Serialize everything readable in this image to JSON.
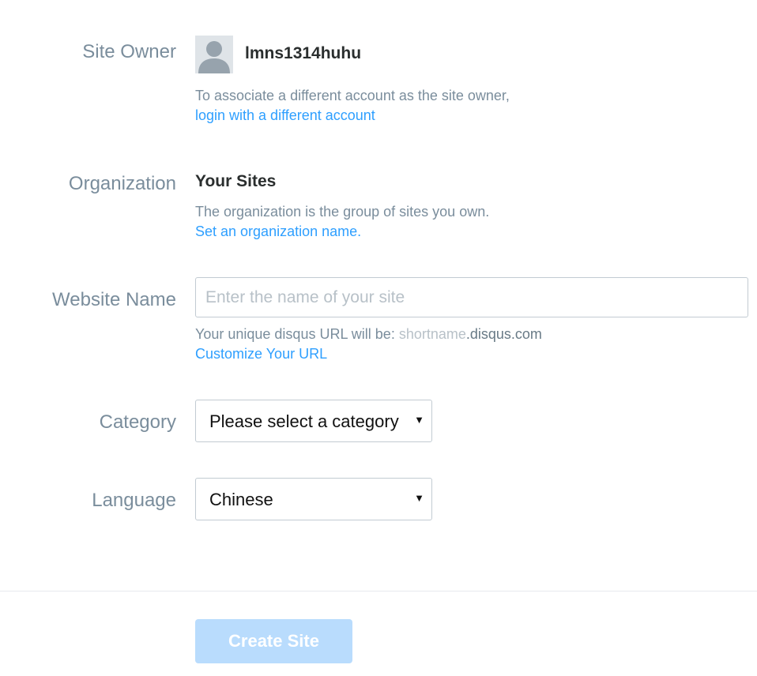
{
  "site_owner": {
    "label": "Site Owner",
    "avatar_icon": "user-avatar-icon",
    "username": "lmns1314huhu",
    "help_text": "To associate a different account as the site owner,",
    "link_text": "login with a different account"
  },
  "organization": {
    "label": "Organization",
    "name": "Your Sites",
    "help_text": "The organization is the group of sites you own.",
    "link_text": "Set an organization name."
  },
  "website_name": {
    "label": "Website Name",
    "placeholder": "Enter the name of your site",
    "value": "",
    "url_prefix": "Your unique disqus URL will be: ",
    "url_shortname": "shortname",
    "url_suffix": ".disqus.com",
    "link_text": "Customize Your URL"
  },
  "category": {
    "label": "Category",
    "selected": "Please select a category",
    "caret_icon": "caret-down-icon"
  },
  "language": {
    "label": "Language",
    "selected": "Chinese",
    "caret_icon": "caret-down-icon"
  },
  "actions": {
    "create_label": "Create Site"
  },
  "colors": {
    "label": "#7a8d9c",
    "link": "#2e9fff",
    "button_disabled": "#b9dcfd",
    "border": "#c2cbd2"
  }
}
